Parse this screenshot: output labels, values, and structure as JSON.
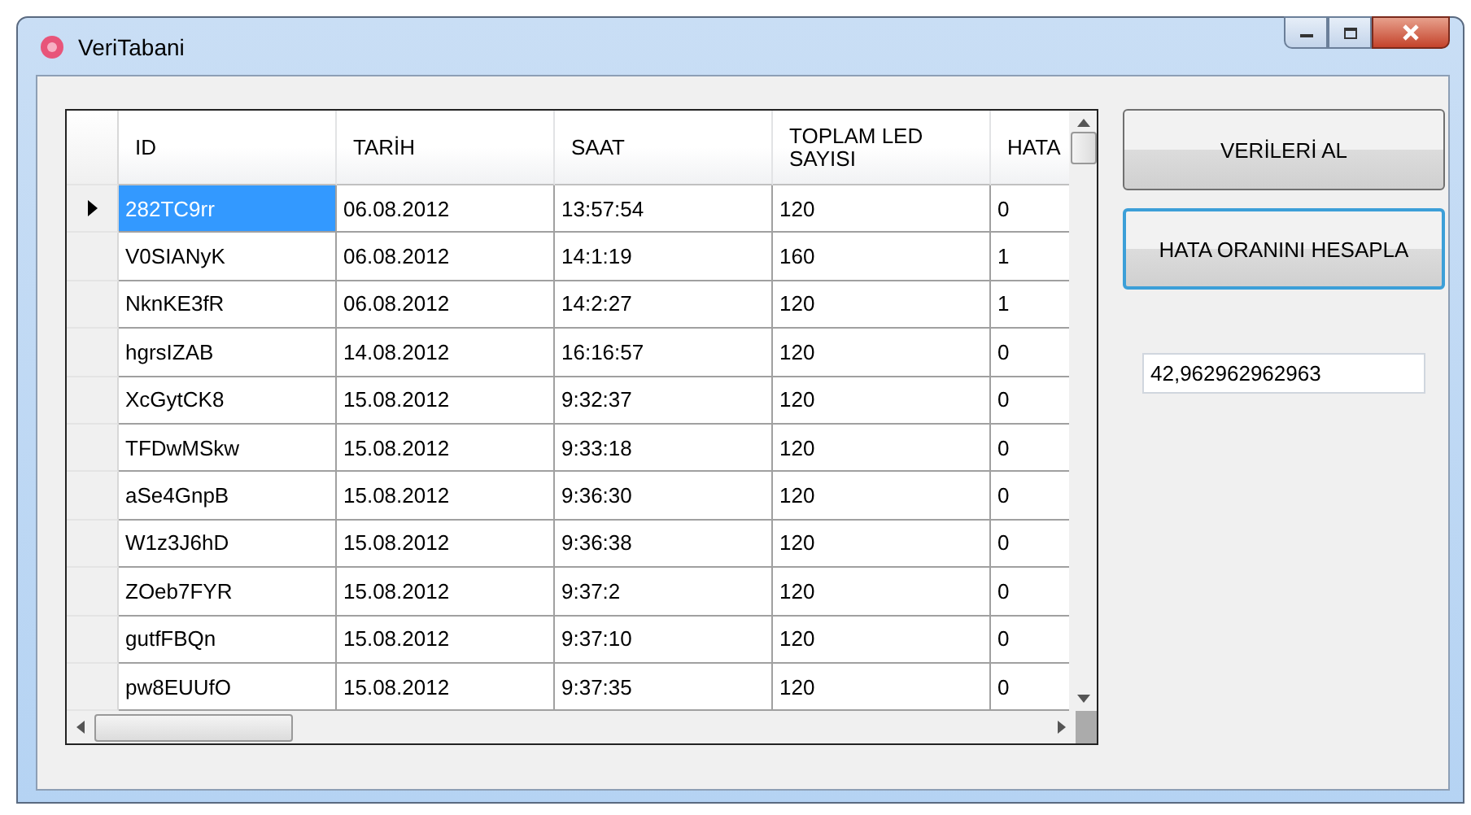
{
  "window": {
    "title": "VeriTabani"
  },
  "grid": {
    "columns": [
      "ID",
      "TARİH",
      "SAAT",
      "TOPLAM LED SAYISI",
      "HATA"
    ],
    "rows": [
      {
        "selected": true,
        "cells": [
          "282TC9rr",
          "06.08.2012",
          "13:57:54",
          "120",
          "0"
        ]
      },
      {
        "selected": false,
        "cells": [
          "V0SIANyK",
          "06.08.2012",
          "14:1:19",
          "160",
          "1"
        ]
      },
      {
        "selected": false,
        "cells": [
          "NknKE3fR",
          "06.08.2012",
          "14:2:27",
          "120",
          "1"
        ]
      },
      {
        "selected": false,
        "cells": [
          "hgrsIZAB",
          "14.08.2012",
          "16:16:57",
          "120",
          "0"
        ]
      },
      {
        "selected": false,
        "cells": [
          "XcGytCK8",
          "15.08.2012",
          "9:32:37",
          "120",
          "0"
        ]
      },
      {
        "selected": false,
        "cells": [
          "TFDwMSkw",
          "15.08.2012",
          "9:33:18",
          "120",
          "0"
        ]
      },
      {
        "selected": false,
        "cells": [
          "aSe4GnpB",
          "15.08.2012",
          "9:36:30",
          "120",
          "0"
        ]
      },
      {
        "selected": false,
        "cells": [
          "W1z3J6hD",
          "15.08.2012",
          "9:36:38",
          "120",
          "0"
        ]
      },
      {
        "selected": false,
        "cells": [
          "ZOeb7FYR",
          "15.08.2012",
          "9:37:2",
          "120",
          "0"
        ]
      },
      {
        "selected": false,
        "cells": [
          "gutfFBQn",
          "15.08.2012",
          "9:37:10",
          "120",
          "0"
        ]
      },
      {
        "selected": false,
        "cells": [
          "pw8EUUfO",
          "15.08.2012",
          "9:37:35",
          "120",
          "0"
        ]
      }
    ]
  },
  "buttons": [
    {
      "label": "VERİLERİ AL",
      "focused": false
    },
    {
      "label": "HATA ORANINI HESAPLA",
      "focused": true
    }
  ],
  "result": {
    "value": "42,962962962963"
  }
}
